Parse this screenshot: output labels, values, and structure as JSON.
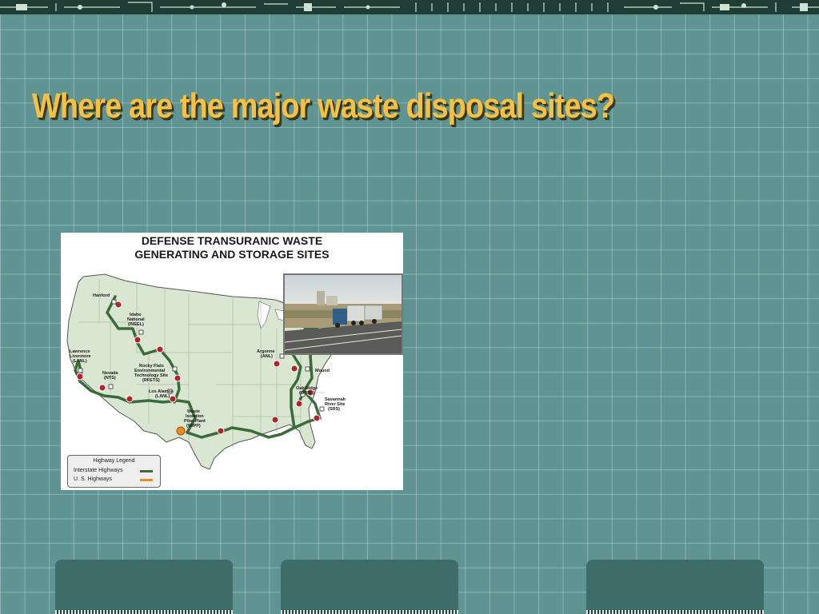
{
  "slide": {
    "title": "Where are the major waste disposal sites?"
  },
  "figure": {
    "heading_line1": "DEFENSE TRANSURANIC WASTE",
    "heading_line2": "GENERATING AND STORAGE SITES",
    "sites": {
      "hanford": "Hanford",
      "ineel": [
        "Idaho",
        "National",
        "(INEEL)"
      ],
      "llnl": [
        "Lawrence",
        "Livermore",
        "(LLNL)"
      ],
      "nts": [
        "Nevada",
        "(NTS)"
      ],
      "rfets": [
        "Rocky Flats",
        "Environmental",
        "Technology Site",
        "(RFETS)"
      ],
      "lanl": [
        "Los Alamos",
        "(LANL)"
      ],
      "wipp": [
        "Waste",
        "Isolation",
        "Pilot Plant",
        "(WIPP)"
      ],
      "anl": [
        "Argonne",
        "(ANL)"
      ],
      "mound": "Mound",
      "ornl": [
        "Oak Ridge",
        "(ORNL)"
      ],
      "srs": [
        "Savannah",
        "River Site",
        "(SRS)"
      ]
    },
    "legend": {
      "title": "Highway Legend",
      "interstate": "Interstate Highways",
      "us": "U. S. Highways"
    }
  },
  "colors": {
    "background": "#5f9492",
    "title": "#f6c043",
    "route": "#3c6b3a",
    "button": "#3e6c69"
  }
}
